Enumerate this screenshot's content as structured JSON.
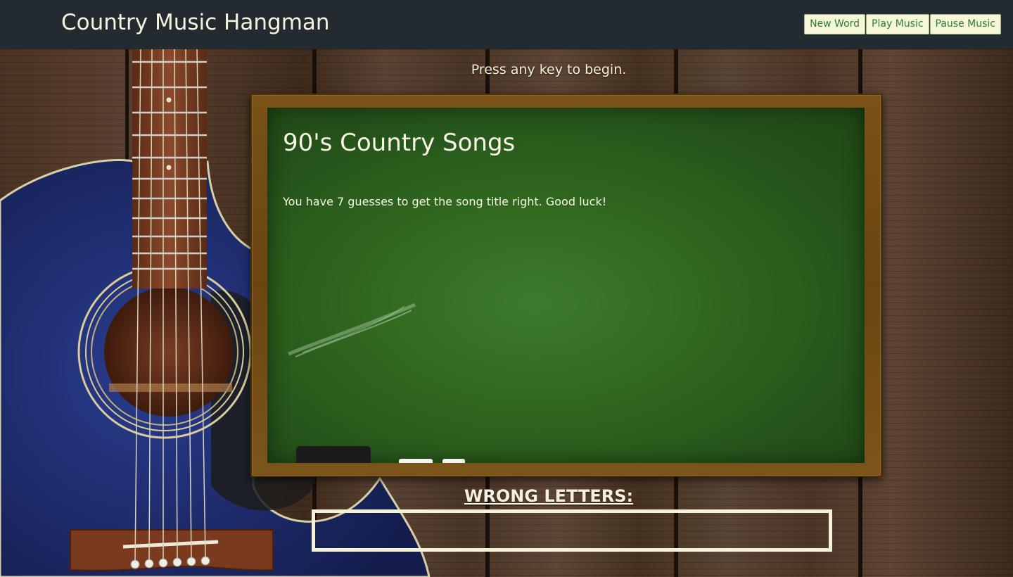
{
  "header": {
    "title": "Country Music Hangman",
    "buttons": {
      "new_word": "New Word",
      "play_music": "Play Music",
      "pause_music": "Pause Music"
    }
  },
  "game": {
    "instruction": "Press any key to begin.",
    "category": "90's Country Songs",
    "guesses_message": "You have 7 guesses to get the song title right. Good luck!",
    "wrong_letters_label": "WRONG LETTERS:",
    "wrong_letters": ""
  },
  "colors": {
    "header_bg": "#232a30",
    "chalkboard_green": "#31691f",
    "frame_wood": "#7a5217",
    "button_text": "#2f7d2f",
    "button_bg": "#f6f6d9",
    "text_cream": "#f6f1dc",
    "guitar_body": "#1f2d6e"
  }
}
